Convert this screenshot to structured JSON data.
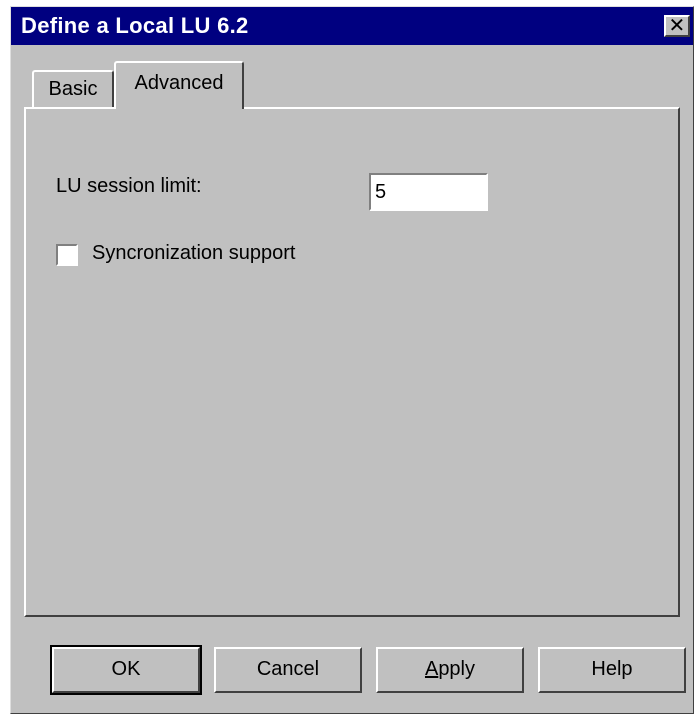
{
  "window": {
    "title": "Define a Local LU 6.2",
    "close_glyph": "✕"
  },
  "tabs": [
    {
      "label": "Basic",
      "selected": false
    },
    {
      "label": "Advanced",
      "selected": true
    }
  ],
  "advanced": {
    "session_limit_label": "LU session limit:",
    "session_limit_value": "5",
    "sync_label": "Syncronization support",
    "sync_checked": false
  },
  "buttons": {
    "ok": "OK",
    "cancel": "Cancel",
    "apply_first": "A",
    "apply_rest": "pply",
    "help": "Help"
  },
  "colors": {
    "titlebar": "#000080",
    "face": "#c0c0c0"
  }
}
